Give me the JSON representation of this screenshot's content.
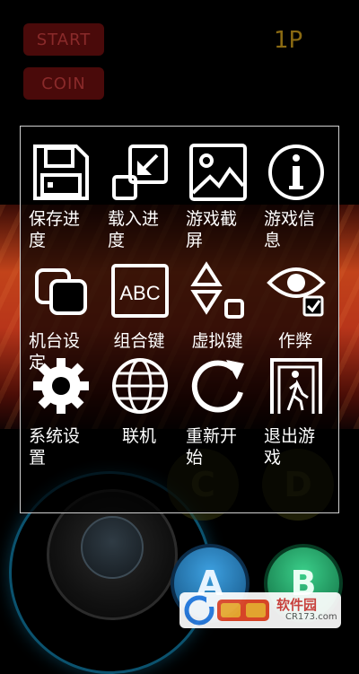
{
  "background": {
    "start_label": "START",
    "coin_label": "COIN",
    "player_label": "1P",
    "buttons": {
      "a": "A",
      "b": "B",
      "c": "C",
      "d": "D"
    }
  },
  "menu": {
    "items": [
      {
        "label": "保存进度",
        "icon": "save-icon"
      },
      {
        "label": "载入进度",
        "icon": "load-icon"
      },
      {
        "label": "游戏截屏",
        "icon": "screenshot-icon"
      },
      {
        "label": "游戏信息",
        "icon": "info-icon"
      },
      {
        "label": "机台设定",
        "icon": "machine-settings-icon"
      },
      {
        "label": "组合键",
        "icon": "combo-keys-icon"
      },
      {
        "label": "虚拟键",
        "icon": "virtual-keys-icon"
      },
      {
        "label": "作弊",
        "icon": "cheat-icon"
      },
      {
        "label": "系统设置",
        "icon": "gear-icon"
      },
      {
        "label": "联机",
        "icon": "globe-icon"
      },
      {
        "label": "重新开始",
        "icon": "restart-icon"
      },
      {
        "label": "退出游戏",
        "icon": "exit-icon"
      }
    ]
  },
  "watermark": {
    "brand": "软件园",
    "url": "CR173.com"
  },
  "colors": {
    "menu_border": "#cfcfcf",
    "icon": "#ffffff",
    "btn_a": "#1f7fc4",
    "btn_b": "#1fa463"
  }
}
